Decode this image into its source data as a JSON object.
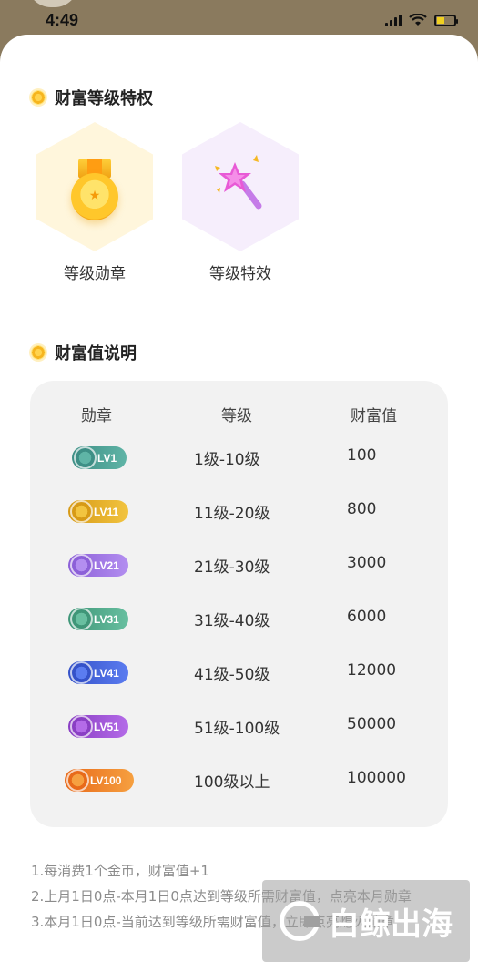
{
  "status_bar": {
    "time": "4:49"
  },
  "privileges": {
    "title": "财富等级特权",
    "items": [
      {
        "label": "等级勋章",
        "icon": "medal-icon"
      },
      {
        "label": "等级特效",
        "icon": "magic-wand-icon"
      }
    ]
  },
  "wealth": {
    "title": "财富值说明",
    "headers": {
      "badge": "勋章",
      "level": "等级",
      "value": "财富值"
    },
    "rows": [
      {
        "badge": "LV1",
        "level": "1级-10级",
        "value": "100",
        "color_a": "#3e8f86",
        "color_b": "#5fb4a6"
      },
      {
        "badge": "LV11",
        "level": "11级-20级",
        "value": "800",
        "color_a": "#d79a16",
        "color_b": "#f2c440"
      },
      {
        "badge": "LV21",
        "level": "21级-30级",
        "value": "3000",
        "color_a": "#8c60d8",
        "color_b": "#b38ef0"
      },
      {
        "badge": "LV31",
        "level": "31级-40级",
        "value": "6000",
        "color_a": "#3f9678",
        "color_b": "#68bfa0"
      },
      {
        "badge": "LV41",
        "level": "41级-50级",
        "value": "12000",
        "color_a": "#3552c9",
        "color_b": "#5b7cf0"
      },
      {
        "badge": "LV51",
        "level": "51级-100级",
        "value": "50000",
        "color_a": "#8a3fc4",
        "color_b": "#b46be8"
      },
      {
        "badge": "LV100",
        "level": "100级以上",
        "value": "100000",
        "color_a": "#e86a1a",
        "color_b": "#f6a040"
      }
    ]
  },
  "notes": {
    "line1": "1.每消费1个金币，财富值+1",
    "line2": "2.上月1日0点-本月1日0点达到等级所需财富值，点亮本月勋章",
    "line3": "3.本月1日0点-当前达到等级所需财富值，立即点亮熄灭勋章"
  },
  "watermark": {
    "text": "白鲸出海"
  }
}
